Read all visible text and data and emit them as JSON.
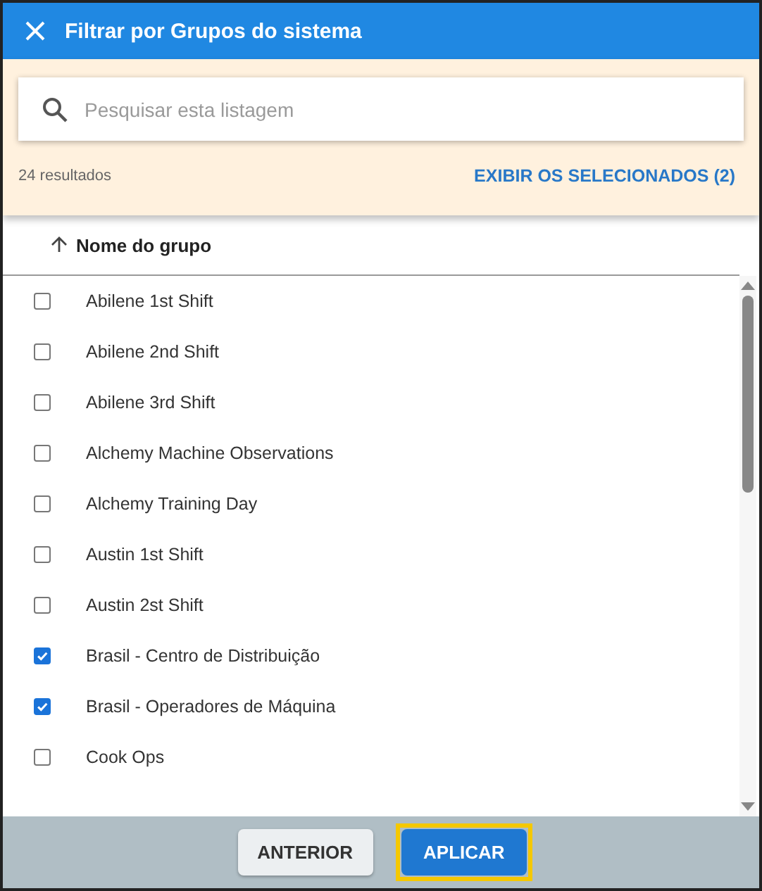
{
  "dialog": {
    "title": "Filtrar por Grupos do sistema"
  },
  "search": {
    "placeholder": "Pesquisar esta listagem"
  },
  "result_count": "24 resultados",
  "show_selected_link": "EXIBIR OS SELECIONADOS (2)",
  "column_header": {
    "label": "Nome do grupo",
    "sorted_ascending": true
  },
  "groups": [
    {
      "name": "Abilene 1st Shift",
      "checked": false
    },
    {
      "name": "Abilene 2nd Shift",
      "checked": false
    },
    {
      "name": "Abilene 3rd Shift",
      "checked": false
    },
    {
      "name": "Alchemy Machine Observations",
      "checked": false
    },
    {
      "name": "Alchemy Training Day",
      "checked": false
    },
    {
      "name": "Austin 1st Shift",
      "checked": false
    },
    {
      "name": "Austin 2st Shift",
      "checked": false
    },
    {
      "name": "Brasil - Centro de Distribuição",
      "checked": true
    },
    {
      "name": "Brasil - Operadores de Máquina",
      "checked": true
    },
    {
      "name": "Cook Ops",
      "checked": false
    }
  ],
  "buttons": [
    {
      "label": "ANTERIOR",
      "kind": "secondary",
      "highlighted": false
    },
    {
      "label": "APLICAR",
      "kind": "primary",
      "highlighted": true
    }
  ]
}
